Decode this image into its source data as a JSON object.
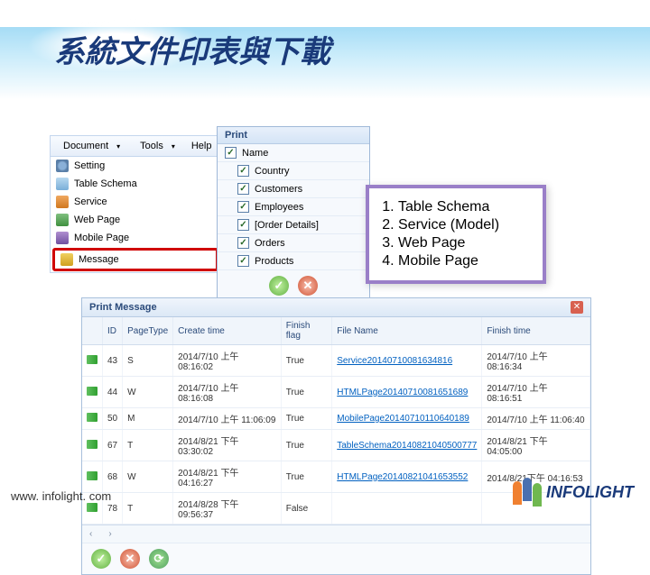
{
  "page_title": "系統文件印表與下載",
  "menubar": {
    "document": "Document",
    "tools": "Tools",
    "help": "Help"
  },
  "sidebar": {
    "items": [
      {
        "label": "Setting"
      },
      {
        "label": "Table Schema"
      },
      {
        "label": "Service"
      },
      {
        "label": "Web Page"
      },
      {
        "label": "Mobile Page"
      },
      {
        "label": "Message"
      }
    ]
  },
  "print_dialog": {
    "title": "Print",
    "options": [
      {
        "label": "Name",
        "checked": true,
        "indent": false
      },
      {
        "label": "Country",
        "checked": true,
        "indent": true
      },
      {
        "label": "Customers",
        "checked": true,
        "indent": true
      },
      {
        "label": "Employees",
        "checked": true,
        "indent": true
      },
      {
        "label": "[Order Details]",
        "checked": true,
        "indent": true
      },
      {
        "label": "Orders",
        "checked": true,
        "indent": true
      },
      {
        "label": "Products",
        "checked": true,
        "indent": true
      }
    ]
  },
  "callout": {
    "items": [
      "Table Schema",
      "Service (Model)",
      "Web Page",
      "Mobile Page"
    ]
  },
  "msg_window": {
    "title": "Print Message",
    "headers": {
      "blank": "",
      "id": "ID",
      "pagetype": "PageType",
      "create": "Create time",
      "flag": "Finish flag",
      "file": "File Name",
      "finish": "Finish time"
    },
    "rows": [
      {
        "id": "43",
        "pt": "S",
        "ct": "2014/7/10 上午 08:16:02",
        "ff": "True",
        "fn": "Service20140710081634816",
        "ft": "2014/7/10 上午 08:16:34"
      },
      {
        "id": "44",
        "pt": "W",
        "ct": "2014/7/10 上午 08:16:08",
        "ff": "True",
        "fn": "HTMLPage20140710081651689",
        "ft": "2014/7/10 上午 08:16:51"
      },
      {
        "id": "50",
        "pt": "M",
        "ct": "2014/7/10 上午 11:06:09",
        "ff": "True",
        "fn": "MobilePage20140710110640189",
        "ft": "2014/7/10 上午 11:06:40"
      },
      {
        "id": "67",
        "pt": "T",
        "ct": "2014/8/21 下午 03:30:02",
        "ff": "True",
        "fn": "TableSchema20140821040500777",
        "ft": "2014/8/21 下午 04:05:00"
      },
      {
        "id": "68",
        "pt": "W",
        "ct": "2014/8/21 下午 04:16:27",
        "ff": "True",
        "fn": "HTMLPage20140821041653552",
        "ft": "2014/8/21下午 04:16:53"
      },
      {
        "id": "78",
        "pt": "T",
        "ct": "2014/8/28 下午 09:56:37",
        "ff": "False",
        "fn": "",
        "ft": ""
      }
    ],
    "pager": {
      "prev": "‹",
      "next": "›"
    }
  },
  "footer": {
    "url": "www. infolight. com",
    "brand": "INFOLIGHT"
  }
}
